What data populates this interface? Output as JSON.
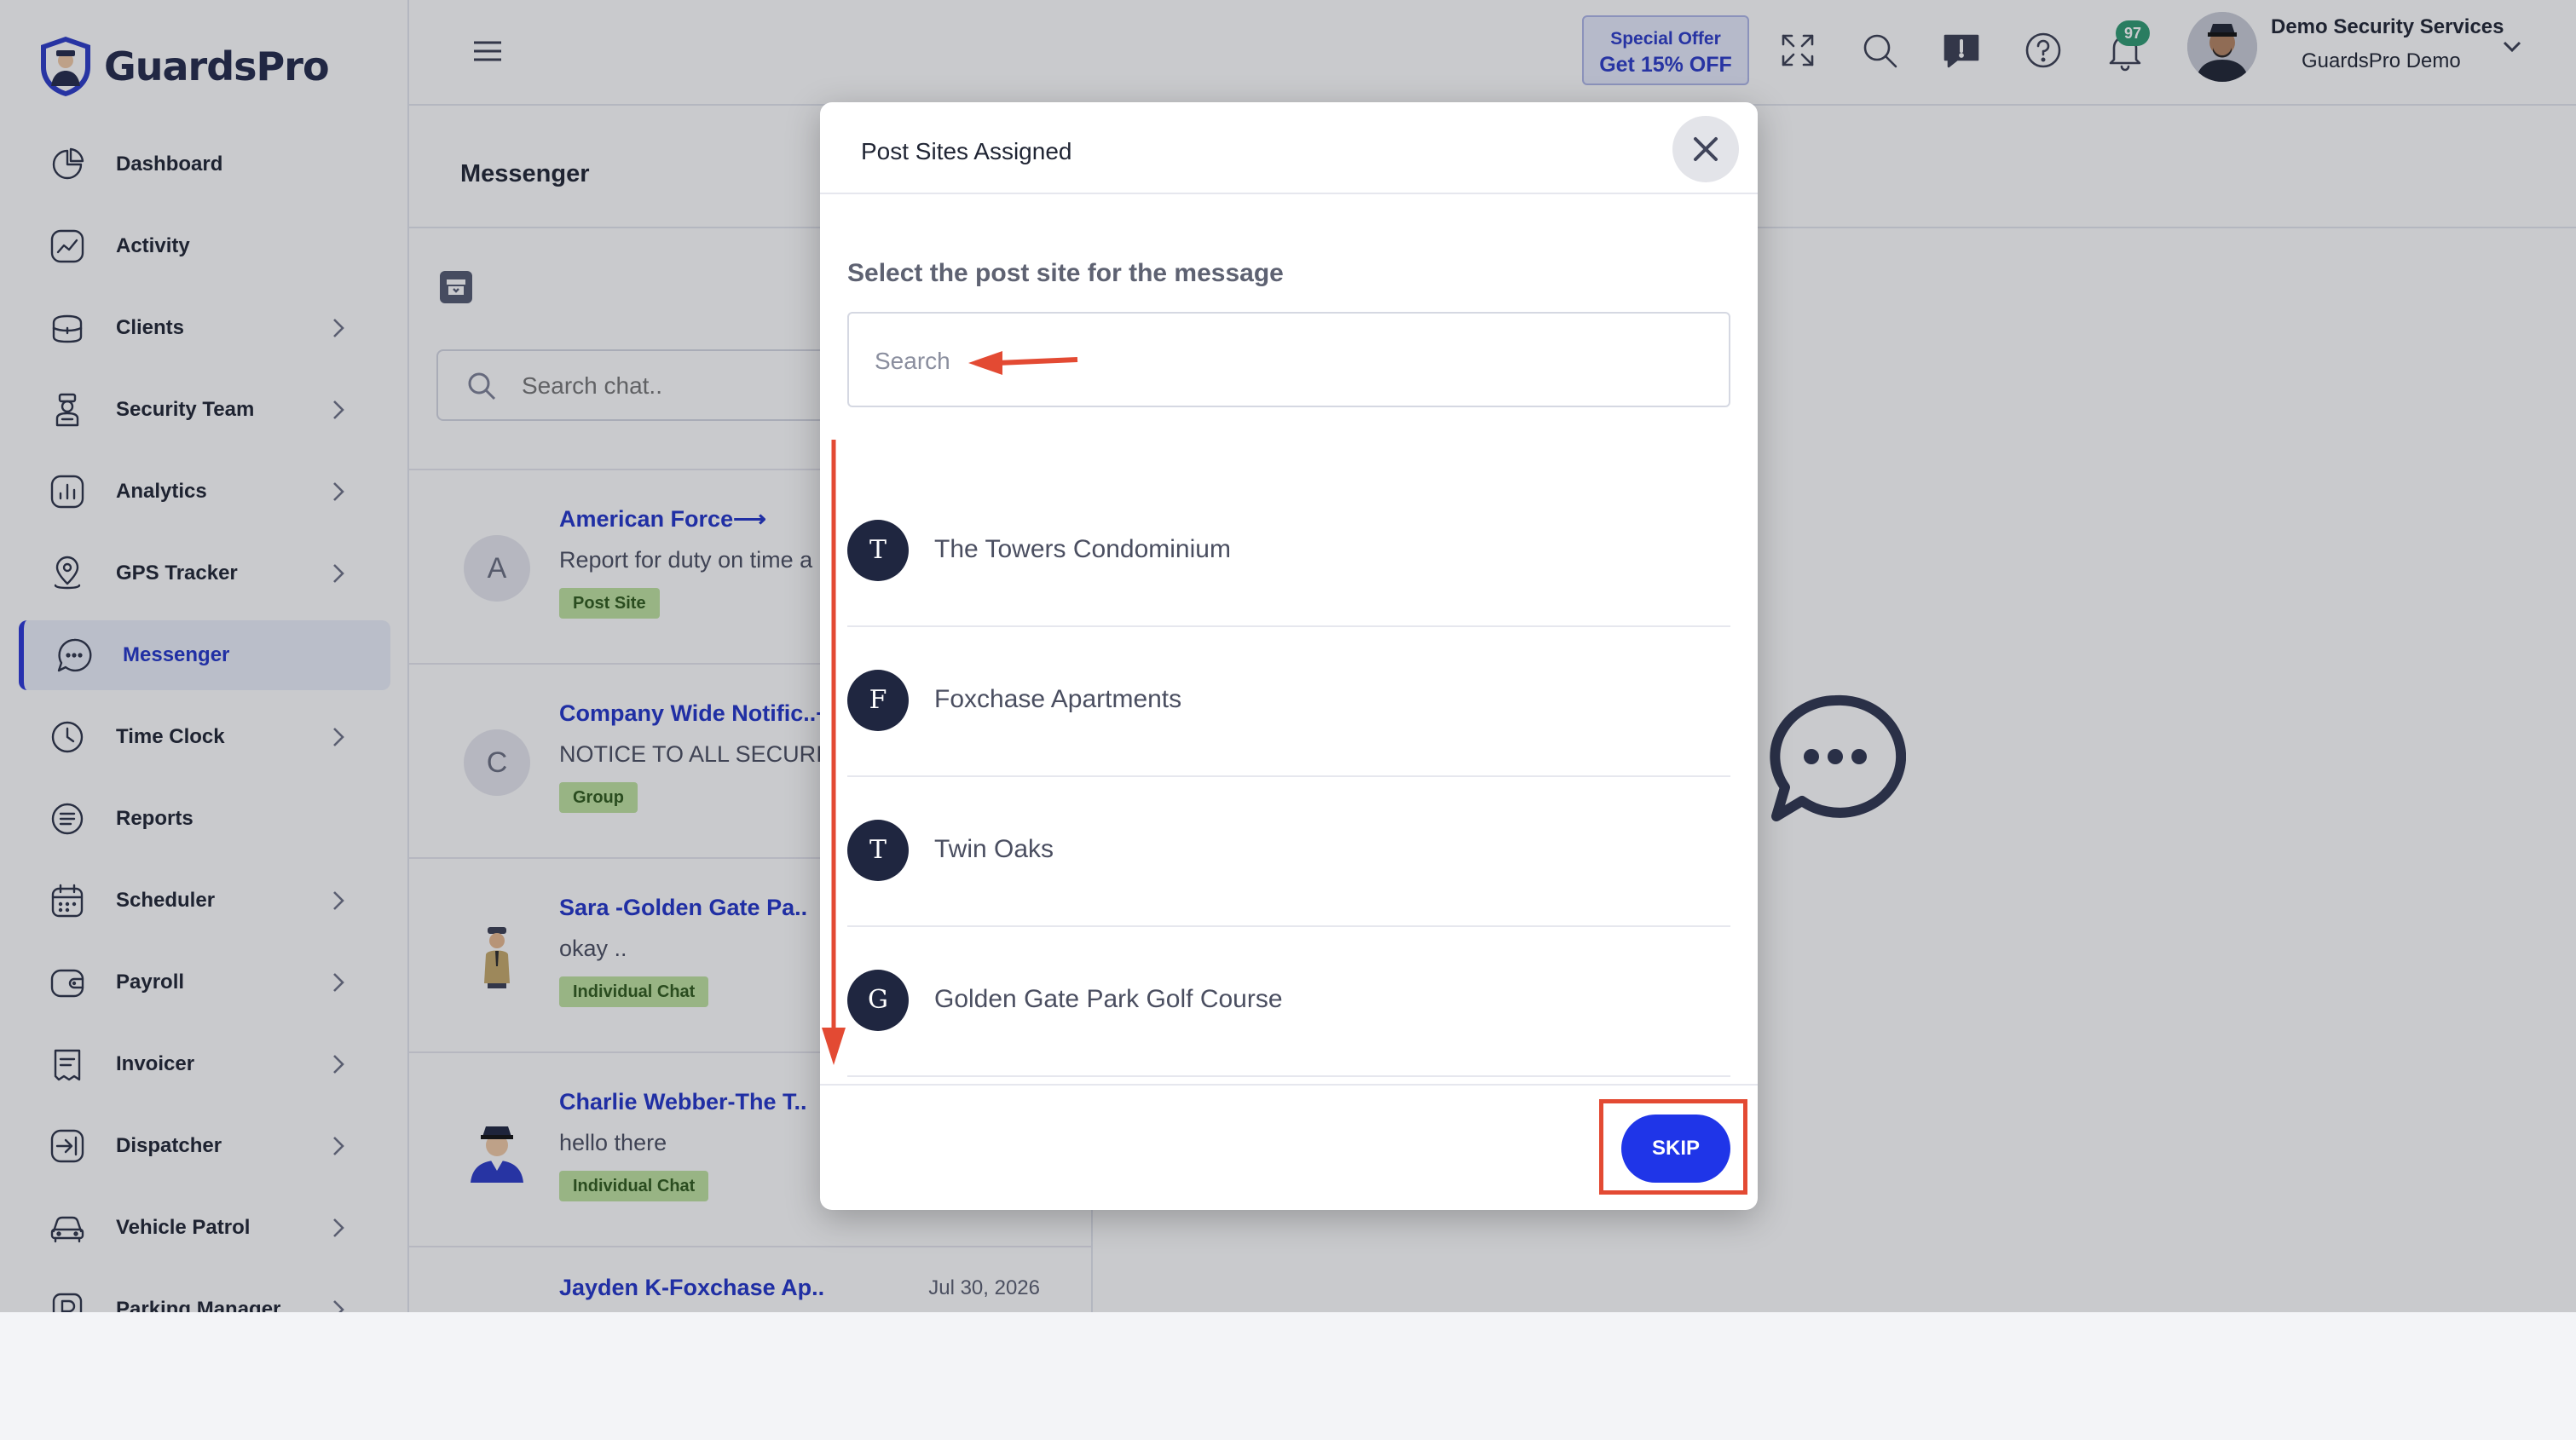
{
  "brand": {
    "name": "GuardsPro"
  },
  "sidebar": {
    "items": [
      {
        "label": "Dashboard",
        "icon": "pie-chart-icon",
        "has_submenu": false
      },
      {
        "label": "Activity",
        "icon": "activity-chart-icon",
        "has_submenu": false
      },
      {
        "label": "Clients",
        "icon": "briefcase-icon",
        "has_submenu": true
      },
      {
        "label": "Security Team",
        "icon": "guard-person-icon",
        "has_submenu": true
      },
      {
        "label": "Analytics",
        "icon": "bar-chart-icon",
        "has_submenu": true
      },
      {
        "label": "GPS Tracker",
        "icon": "map-pin-icon",
        "has_submenu": true
      },
      {
        "label": "Messenger",
        "icon": "chat-bubble-icon",
        "has_submenu": false,
        "active": true
      },
      {
        "label": "Time Clock",
        "icon": "clock-icon",
        "has_submenu": true
      },
      {
        "label": "Reports",
        "icon": "report-list-icon",
        "has_submenu": false
      },
      {
        "label": "Scheduler",
        "icon": "calendar-icon",
        "has_submenu": true
      },
      {
        "label": "Payroll",
        "icon": "wallet-icon",
        "has_submenu": true
      },
      {
        "label": "Invoicer",
        "icon": "invoice-icon",
        "has_submenu": true
      },
      {
        "label": "Dispatcher",
        "icon": "dispatch-arrow-icon",
        "has_submenu": true
      },
      {
        "label": "Vehicle Patrol",
        "icon": "car-icon",
        "has_submenu": true
      },
      {
        "label": "Parking Manager",
        "icon": "parking-icon",
        "has_submenu": true
      }
    ]
  },
  "topbar": {
    "offer_line1": "Special Offer",
    "offer_line2": "Get 15% OFF",
    "notification_count": "97",
    "user_name": "Demo Security Services",
    "user_company": "GuardsPro Demo"
  },
  "messenger": {
    "title": "Messenger",
    "search_placeholder": "Search chat..",
    "chats": [
      {
        "initial": "A",
        "name": "American Force⟶",
        "preview": "Report for duty on time a",
        "tag": "Post Site",
        "date": ""
      },
      {
        "initial": "C",
        "name": "Company Wide Notific..⟶",
        "preview": "NOTICE TO ALL SECURIT",
        "tag": "Group",
        "date": ""
      },
      {
        "initial": "",
        "name": "Sara -Golden Gate Pa..",
        "preview": "okay ..",
        "tag": "Individual Chat",
        "date": ""
      },
      {
        "initial": "",
        "name": "Charlie Webber-The T..",
        "preview": "hello there",
        "tag": "Individual Chat",
        "date": ""
      },
      {
        "initial": "",
        "name": "Jayden K-Foxchase Ap..",
        "preview": "",
        "tag": "",
        "date": "Jul 30, 2026"
      }
    ]
  },
  "modal": {
    "title": "Post Sites Assigned",
    "subtitle": "Select the post site for the message",
    "search_placeholder": "Search",
    "sites": [
      {
        "initial": "T",
        "name": "The Towers Condominium"
      },
      {
        "initial": "F",
        "name": "Foxchase Apartments"
      },
      {
        "initial": "T",
        "name": "Twin Oaks"
      },
      {
        "initial": "G",
        "name": "Golden Gate Park Golf Course"
      }
    ],
    "skip_label": "SKIP"
  },
  "colors": {
    "accent": "#1f35e8",
    "link": "#2234c9",
    "tag_bg": "#bfe3a0",
    "badge": "#2f9a72",
    "annotation": "#e34a33",
    "site_avatar": "#1f2640"
  }
}
